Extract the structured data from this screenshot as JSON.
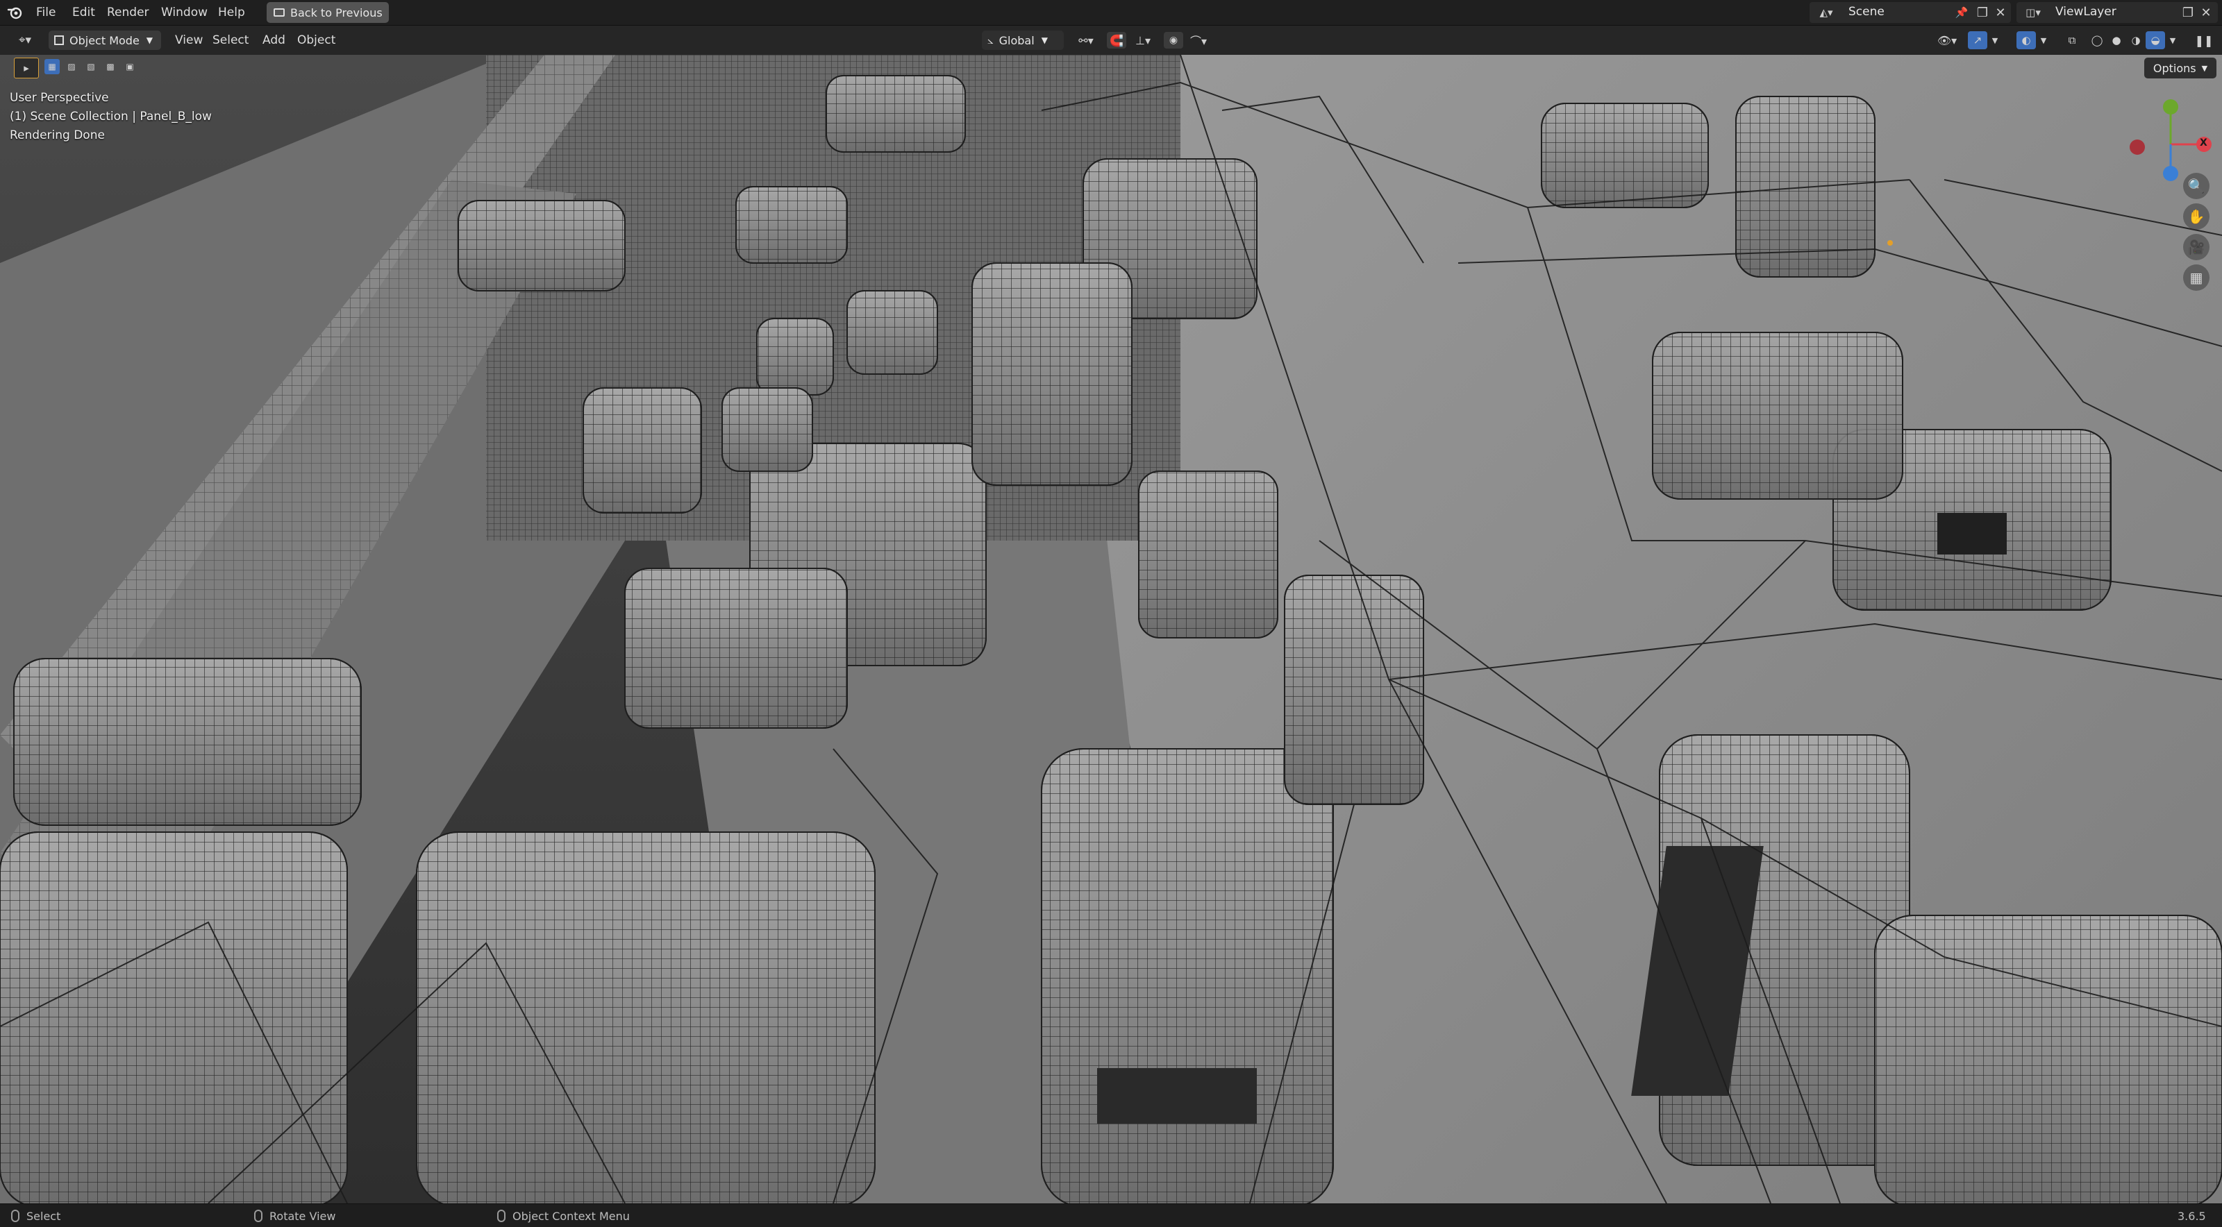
{
  "topbar": {
    "menus": [
      "File",
      "Edit",
      "Render",
      "Window",
      "Help"
    ],
    "back_button": "Back to Previous",
    "scene_name": "Scene",
    "view_layer": "ViewLayer"
  },
  "header": {
    "mode": "Object Mode",
    "menus": [
      "View",
      "Select",
      "Add",
      "Object"
    ],
    "orientation": "Global",
    "options": "Options"
  },
  "overlay": {
    "line1": "User Perspective",
    "line2": "(1) Scene Collection | Panel_B_low",
    "line3": "Rendering Done"
  },
  "gizmo": {
    "x_label": "X",
    "colors": {
      "x": "#e0424c",
      "y": "#6ca82c",
      "z": "#3a7fd6"
    }
  },
  "statusbar": {
    "select": "Select",
    "rotate": "Rotate View",
    "context": "Object Context Menu",
    "version": "3.6.5"
  },
  "colors": {
    "accent": "#3d6eb8",
    "viewport_bg": "#5a5a5a",
    "surface": "#8b8b8b"
  }
}
